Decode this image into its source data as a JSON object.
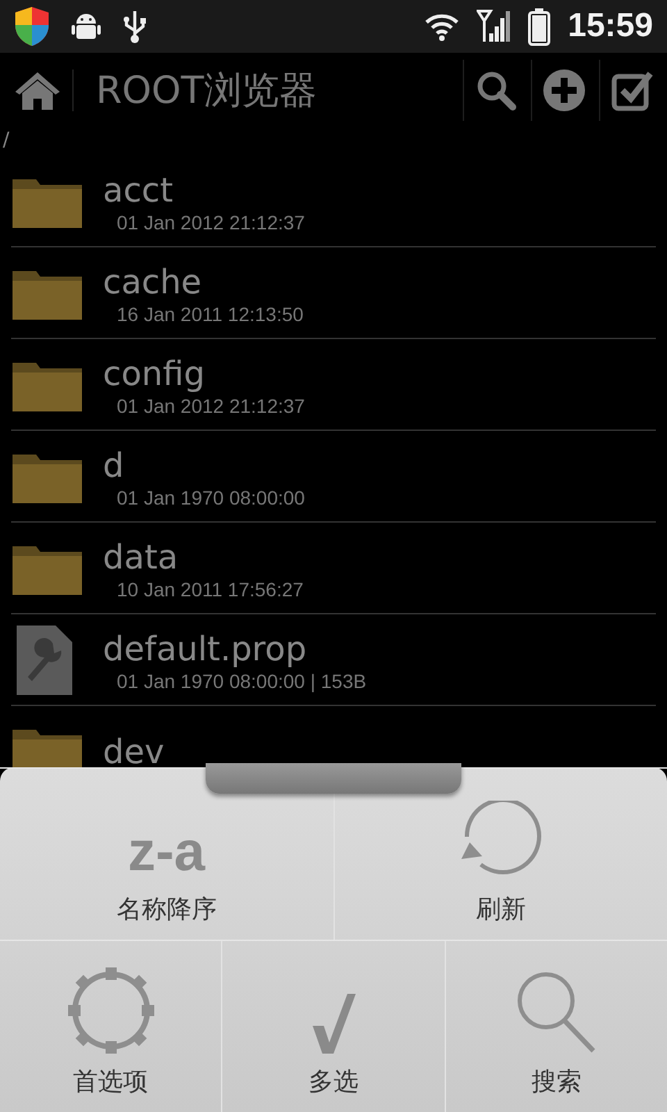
{
  "status_bar": {
    "time": "15:59"
  },
  "action_bar": {
    "title": "ROOT浏览器"
  },
  "path": "/",
  "files": [
    {
      "kind": "folder",
      "name": "acct",
      "info": "01 Jan 2012 21:12:37"
    },
    {
      "kind": "folder",
      "name": "cache",
      "info": "16 Jan 2011 12:13:50"
    },
    {
      "kind": "folder",
      "name": "config",
      "info": "01 Jan 2012 21:12:37"
    },
    {
      "kind": "folder",
      "name": "d",
      "info": "01 Jan 1970 08:00:00"
    },
    {
      "kind": "folder",
      "name": "data",
      "info": "10 Jan 2011 17:56:27"
    },
    {
      "kind": "file",
      "name": "default.prop",
      "info": "01 Jan 1970 08:00:00 | 153B"
    },
    {
      "kind": "folder",
      "name": "dev"
    }
  ],
  "menu": {
    "rows": [
      [
        {
          "kind": "sort",
          "icon_text": "z-a",
          "label": "名称降序"
        },
        {
          "kind": "refresh",
          "label": "刷新"
        }
      ],
      [
        {
          "kind": "settings",
          "label": "首选项"
        },
        {
          "kind": "check",
          "label": "多选"
        },
        {
          "kind": "search",
          "label": "搜索"
        }
      ]
    ]
  }
}
